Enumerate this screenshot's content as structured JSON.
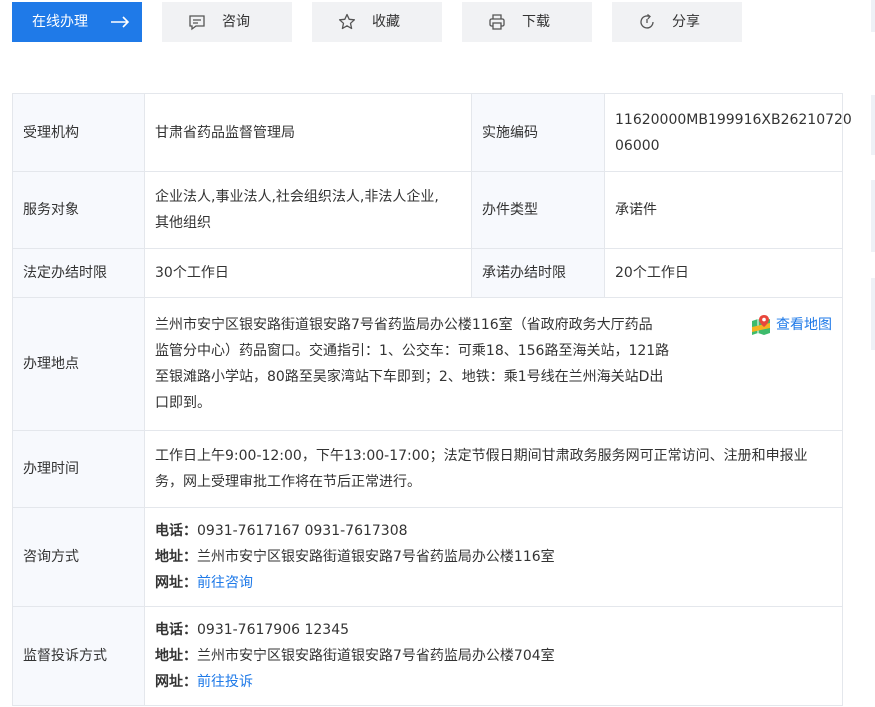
{
  "toolbar": {
    "online": "在线办理",
    "consult": "咨询",
    "favorite": "收藏",
    "download": "下载",
    "share": "分享"
  },
  "info": {
    "agency_label": "受理机构",
    "agency_value": "甘肃省药品监督管理局",
    "code_label": "实施编码",
    "code_value_1": "11620000MB199916XB26210720",
    "code_value_2": "06000",
    "target_label": "服务对象",
    "target_value_1": "企业法人,事业法人,社会组织法人,非法人企业,",
    "target_value_2": "其他组织",
    "type_label": "办件类型",
    "type_value": "承诺件",
    "legal_label": "法定办结时限",
    "legal_value": "30个工作日",
    "promise_label": "承诺办结时限",
    "promise_value": "20个工作日",
    "location_label": "办理地点",
    "location_lines": [
      "兰州市安宁区银安路街道银安路7号省药监局办公楼116室（省政府政务大厅药品",
      "监管分中心）药品窗口。交通指引：1、公交车：可乘18、156路至海关站，121路",
      "至银滩路小学站，80路至吴家湾站下车即到；2、地铁：乘1号线在兰州海关站D出",
      "口即到。"
    ],
    "map_link": "查看地图",
    "time_label": "办理时间",
    "time_lines": [
      "工作日上午9:00-12:00，下午13:00-17:00；法定节假日期间甘肃政务服务网可正常访问、注册和申报业",
      "务，网上受理审批工作将在节后正常进行。"
    ],
    "consult_label": "咨询方式",
    "consult_phone_key": "电话：",
    "consult_phone": "0931-7617167 0931-7617308",
    "consult_addr_key": "地址：",
    "consult_addr": "兰州市安宁区银安路街道银安路7号省药监局办公楼116室",
    "consult_web_key": "网址：",
    "consult_web": "前往咨询",
    "complain_label": "监督投诉方式",
    "complain_phone_key": "电话：",
    "complain_phone": "0931-7617906 12345",
    "complain_addr_key": "地址：",
    "complain_addr": "兰州市安宁区银安路街道银安路7号省药监局办公楼704室",
    "complain_web_key": "网址：",
    "complain_web": "前往投诉"
  },
  "colors": {
    "primary": "#1f7ae8",
    "button_bg": "#f1f2f4",
    "label_bg": "#f7f9fd",
    "border": "#e4e7ec"
  }
}
